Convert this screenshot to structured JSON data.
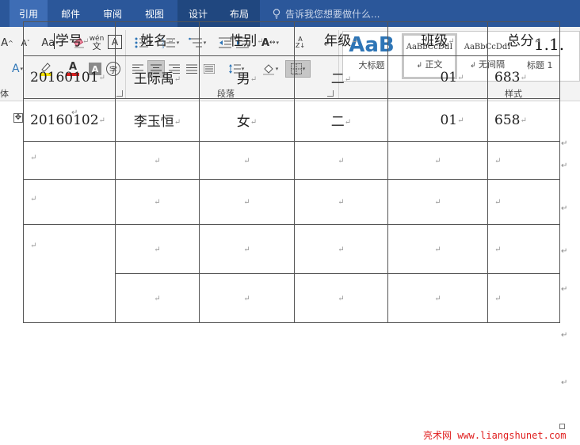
{
  "tabs": [
    {
      "label": "引用"
    },
    {
      "label": "邮件"
    },
    {
      "label": "审阅"
    },
    {
      "label": "视图"
    },
    {
      "label": "设计"
    },
    {
      "label": "布局"
    }
  ],
  "search": {
    "text": "告诉我您想要做什么..."
  },
  "ribbon": {
    "font_group": {
      "label": "体",
      "aa_label": "Aa",
      "char_A_label": "A",
      "font_color_label": "A",
      "pinyin_label": "wén",
      "font_border_label": "A"
    },
    "paragraph_group": {
      "label": "段落"
    },
    "styles_group": {
      "label": "样式"
    },
    "styles": [
      {
        "preview": "AaB",
        "name": "大标题"
      },
      {
        "preview": "AaBbCcDdI",
        "name": "正文"
      },
      {
        "preview": "AaBbCcDdI",
        "name": "无间隔"
      },
      {
        "preview": "1.1.",
        "name": "标题 1"
      }
    ],
    "colors": {
      "highlight": "#f5e100",
      "font_color": "#d82020",
      "shading_fill": "#bfbfbf",
      "ribbon_bg": "#f3f3f3",
      "tab_bg": "#2b579a"
    }
  },
  "table": {
    "headers": [
      "学号",
      "姓名",
      "性别",
      "年级",
      "班级",
      "总分"
    ],
    "rows": [
      [
        "20160101",
        "王际禹",
        "男",
        "二",
        "01",
        "683"
      ],
      [
        "20160102",
        "李玉恒",
        "女",
        "二",
        "01",
        "658"
      ]
    ],
    "paragraph_mark": "↵"
  },
  "watermark": {
    "text": "亮术网 www.liangshunet.com"
  }
}
